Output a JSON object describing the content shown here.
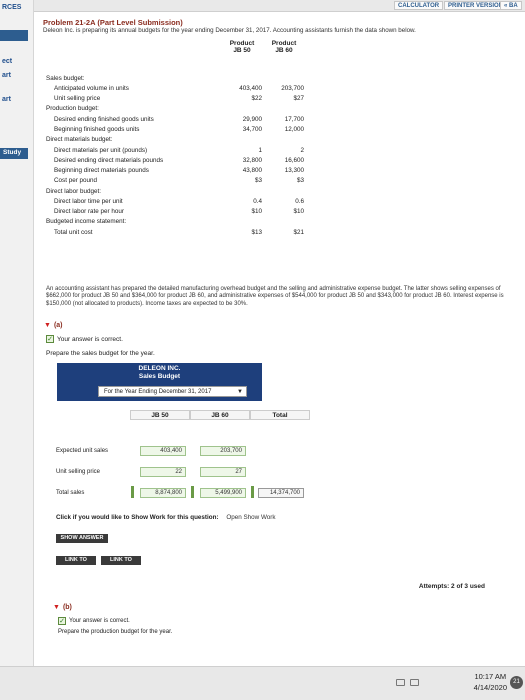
{
  "header": {
    "calculator": "CALCULATOR",
    "printer_version": "PRINTER VERSION",
    "next": "« BA"
  },
  "left_nav": {
    "item1": "RCES",
    "item2": "ect",
    "item3": "art",
    "item4": "art",
    "item5": "Study"
  },
  "problem": {
    "title": "Problem 21-2A (Part Level Submission)",
    "intro": "Deleon Inc. is preparing its annual budgets for the year ending December 31, 2017. Accounting assistants furnish the data shown below.",
    "col1_line1": "Product",
    "col1_line2": "JB 50",
    "col2_line1": "Product",
    "col2_line2": "JB 60",
    "rows": [
      {
        "label": "Sales budget:",
        "v1": "",
        "v2": ""
      },
      {
        "label": "Anticipated volume in units",
        "v1": "403,400",
        "v2": "203,700"
      },
      {
        "label": "Unit selling price",
        "v1": "$22",
        "v2": "$27"
      },
      {
        "label": "Production budget:",
        "v1": "",
        "v2": ""
      },
      {
        "label": "Desired ending finished goods units",
        "v1": "29,900",
        "v2": "17,700"
      },
      {
        "label": "Beginning finished goods units",
        "v1": "34,700",
        "v2": "12,000"
      },
      {
        "label": "Direct materials budget:",
        "v1": "",
        "v2": ""
      },
      {
        "label": "Direct materials per unit (pounds)",
        "v1": "1",
        "v2": "2"
      },
      {
        "label": "Desired ending direct materials pounds",
        "v1": "32,800",
        "v2": "16,600"
      },
      {
        "label": "Beginning direct materials pounds",
        "v1": "43,800",
        "v2": "13,300"
      },
      {
        "label": "Cost per pound",
        "v1": "$3",
        "v2": "$3"
      },
      {
        "label": "Direct labor budget:",
        "v1": "",
        "v2": ""
      },
      {
        "label": "Direct labor time per unit",
        "v1": "0.4",
        "v2": "0.6"
      },
      {
        "label": "Direct labor rate per hour",
        "v1": "$10",
        "v2": "$10"
      },
      {
        "label": "Budgeted income statement:",
        "v1": "",
        "v2": ""
      },
      {
        "label": "Total unit cost",
        "v1": "$13",
        "v2": "$21"
      }
    ],
    "narrative": "An accounting assistant has prepared the detailed manufacturing overhead budget and the selling and administrative expense budget. The latter shows selling expenses of $662,000 for product JB 50 and $364,000 for product JB 60, and administrative expenses of $544,000 for product JB 50 and $343,000 for product JB 60. Interest expense is $150,000 (not allocated to products). Income taxes are expected to be 30%."
  },
  "part_a": {
    "label": "(a)",
    "correct_text": "Your answer is correct.",
    "prompt": "Prepare the sales budget for the year.",
    "company": "DELEON INC.",
    "budget_name": "Sales Budget",
    "period_select": "For the Year Ending December 31, 2017",
    "col_jb50": "JB 50",
    "col_jb60": "JB 60",
    "col_total": "Total",
    "row_units": "Expected unit sales",
    "row_price": "Unit selling price",
    "row_sales": "Total sales",
    "units_jb50": "403,400",
    "units_jb60": "203,700",
    "price_jb50": "22",
    "price_jb60": "27",
    "sales_jb50": "8,874,800",
    "sales_jb60": "5,499,900",
    "sales_total": "14,374,700",
    "show_work_question": "Click if you would like to Show Work for this question:",
    "show_work_link": "Open Show Work",
    "show_answer_btn": "SHOW ANSWER",
    "link_text_btn": "LINK TO TEXT",
    "link_text_btn2": "LINK TO TEXT",
    "attempts": "Attempts: 2 of 3 used"
  },
  "part_b": {
    "label": "(b)",
    "correct_text": "Your answer is correct.",
    "prompt": "Prepare the production budget for the year."
  },
  "taskbar": {
    "time": "10:17 AM",
    "date": "4/14/2020",
    "notifications": "21"
  }
}
